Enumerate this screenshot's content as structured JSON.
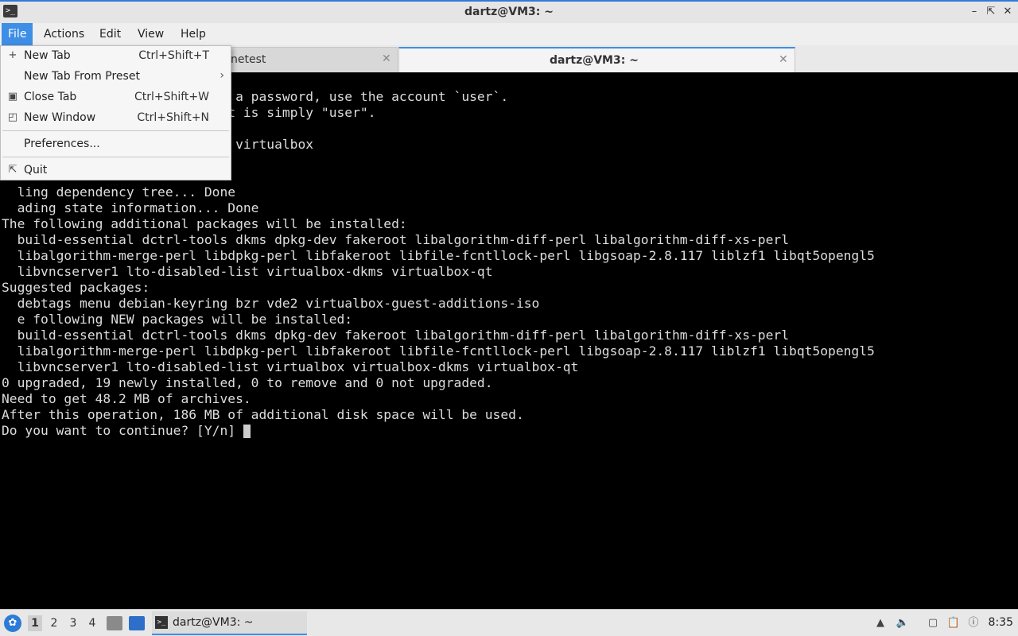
{
  "window": {
    "title": "dartz@VM3: ~"
  },
  "menubar": {
    "items": [
      "File",
      "Actions",
      "Edit",
      "View",
      "Help"
    ]
  },
  "tabs": [
    {
      "label": "netest"
    },
    {
      "label": "dartz@VM3: ~"
    }
  ],
  "file_menu": {
    "items": [
      {
        "label": "New Tab",
        "shortcut": "Ctrl+Shift+T",
        "icon": "plus-icon"
      },
      {
        "label": "New Tab From Preset",
        "shortcut": "",
        "icon": ""
      },
      {
        "label": "Close Tab",
        "shortcut": "Ctrl+Shift+W",
        "icon": "close-tab-icon"
      },
      {
        "label": "New Window",
        "shortcut": "Ctrl+Shift+N",
        "icon": "new-window-icon"
      },
      {
        "label": "Preferences...",
        "shortcut": "",
        "icon": ""
      },
      {
        "label": "Quit",
        "shortcut": "",
        "icon": "quit-icon"
      }
    ]
  },
  "terminal": {
    "lines": [
      "",
      "                              a password, use the account `user`.",
      "                             t is simply \"user\".",
      "",
      "                              virtualbox",
      "",
      "",
      "  ling dependency tree... Done",
      "  ading state information... Done",
      "The following additional packages will be installed:",
      "  build-essential dctrl-tools dkms dpkg-dev fakeroot libalgorithm-diff-perl libalgorithm-diff-xs-perl",
      "  libalgorithm-merge-perl libdpkg-perl libfakeroot libfile-fcntllock-perl libgsoap-2.8.117 liblzf1 libqt5opengl5",
      "  libvncserver1 lto-disabled-list virtualbox-dkms virtualbox-qt",
      "Suggested packages:",
      "  debtags menu debian-keyring bzr vde2 virtualbox-guest-additions-iso",
      "  e following NEW packages will be installed:",
      "  build-essential dctrl-tools dkms dpkg-dev fakeroot libalgorithm-diff-perl libalgorithm-diff-xs-perl",
      "  libalgorithm-merge-perl libdpkg-perl libfakeroot libfile-fcntllock-perl libgsoap-2.8.117 liblzf1 libqt5opengl5",
      "  libvncserver1 lto-disabled-list virtualbox virtualbox-dkms virtualbox-qt",
      "0 upgraded, 19 newly installed, 0 to remove and 0 not upgraded.",
      "Need to get 48.2 MB of archives.",
      "After this operation, 186 MB of additional disk space will be used.",
      "Do you want to continue? [Y/n] "
    ]
  },
  "taskbar": {
    "desktops": [
      "1",
      "2",
      "3",
      "4"
    ],
    "task_label": "dartz@VM3: ~",
    "clock": "8:35"
  }
}
